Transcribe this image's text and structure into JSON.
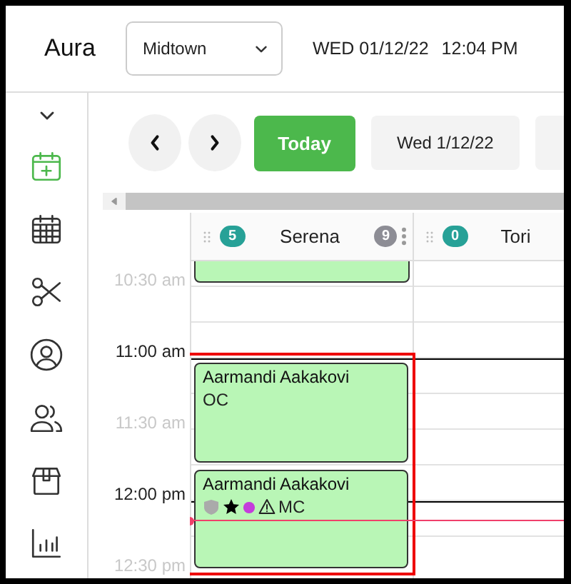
{
  "header": {
    "app_name": "Aura",
    "location": {
      "value": "Midtown"
    },
    "date": "WED 01/12/22",
    "time": "12:04 PM"
  },
  "sidebar": {
    "items": [
      {
        "kind": "chevron",
        "selected": false
      },
      {
        "kind": "calendar-plus",
        "selected": true
      },
      {
        "kind": "calendar",
        "selected": false
      },
      {
        "kind": "scissors",
        "selected": false
      },
      {
        "kind": "user",
        "selected": false
      },
      {
        "kind": "users",
        "selected": false
      },
      {
        "kind": "box",
        "selected": false
      },
      {
        "kind": "chart",
        "selected": false
      }
    ]
  },
  "toolbar": {
    "today": "Today",
    "date": "Wed 1/12/22"
  },
  "columns": [
    {
      "name": "Serena",
      "count": "5",
      "extra_count": "9",
      "events": [
        {
          "selected": false
        },
        {
          "selected": true,
          "title": "Aarmandi Aakakovi",
          "note": "OC"
        },
        {
          "selected": true,
          "title": "Aarmandi Aakakovi",
          "tags": [
            {
              "kind": "shield"
            },
            {
              "kind": "star"
            },
            {
              "kind": "dot",
              "color": "#c43ddb"
            },
            {
              "kind": "warning"
            }
          ],
          "note": "MC"
        }
      ]
    },
    {
      "name": "Tori",
      "count": "0"
    }
  ],
  "time_labels": [
    {
      "label": "10:30 am",
      "kind": "half"
    },
    {
      "label": "11:00 am",
      "kind": "hour"
    },
    {
      "label": "11:30 am",
      "kind": "half"
    },
    {
      "label": "12:00 pm",
      "kind": "hour"
    },
    {
      "label": "12:30 pm",
      "kind": "half"
    }
  ],
  "now_indicator": true
}
